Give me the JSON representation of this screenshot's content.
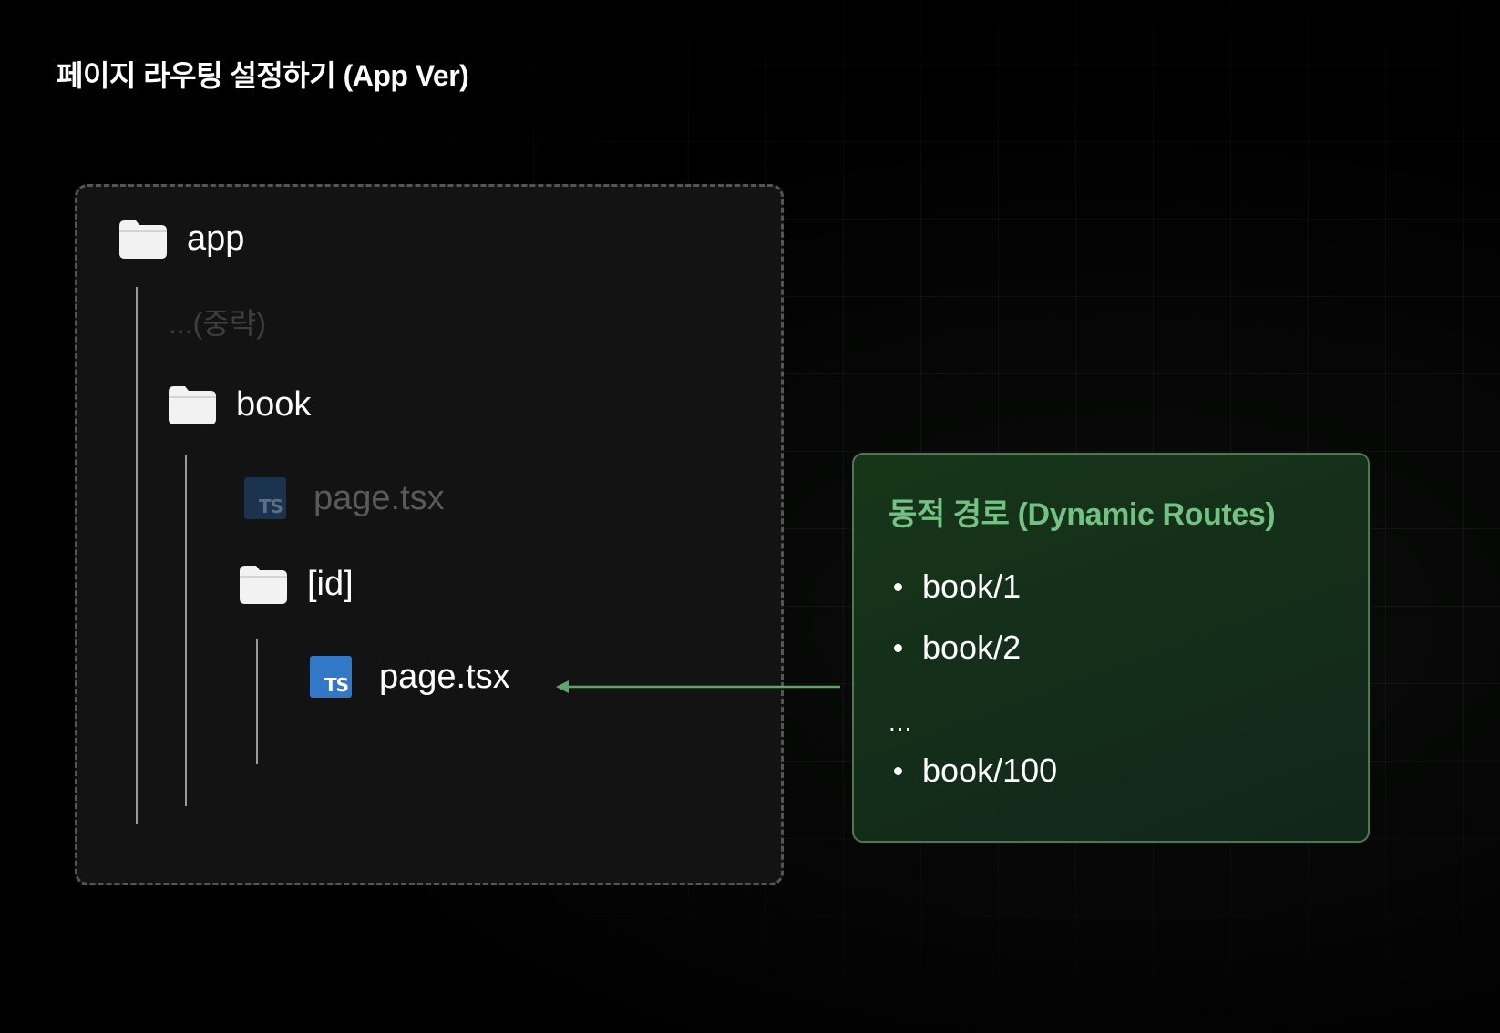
{
  "title": "페이지 라우팅 설정하기 (App Ver)",
  "tree": {
    "app": {
      "label": "app",
      "icon": "folder-icon"
    },
    "omitted": {
      "label": "...(중략)"
    },
    "book": {
      "label": "book",
      "icon": "folder-icon"
    },
    "book_page": {
      "label": "page.tsx",
      "icon": "typescript-file-icon",
      "badge": "TS",
      "dimmed": true
    },
    "id_folder": {
      "label": "[id]",
      "icon": "folder-icon"
    },
    "id_page": {
      "label": "page.tsx",
      "icon": "typescript-file-icon",
      "badge": "TS",
      "dimmed": false
    }
  },
  "info": {
    "title": "동적 경로 (Dynamic Routes)",
    "routes": [
      "book/1",
      "book/2",
      "book/100"
    ],
    "ellipsis": "..."
  },
  "colors": {
    "background": "#000000",
    "accent_green": "#74c283",
    "info_border": "#4b7a50",
    "ts_blue": "#3178c6",
    "arrow": "#5fa56b"
  }
}
